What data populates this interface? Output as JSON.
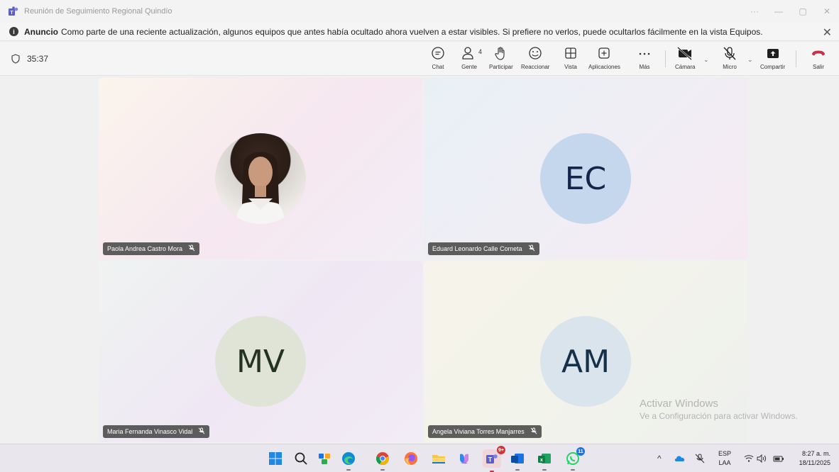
{
  "window": {
    "title": "Reunión de Seguimiento Regional Quindío"
  },
  "announcement": {
    "label": "Anuncio",
    "text": "Como parte de una reciente actualización, algunos equipos que antes había ocultado ahora vuelven a estar visibles. Si prefiere no verlos, puede ocultarlos fácilmente en la vista Equipos."
  },
  "toolbar": {
    "timer": "35:37",
    "chat": "Chat",
    "people": "Gente",
    "people_count": "4",
    "raise": "Participar",
    "react": "Reaccionar",
    "view": "Vista",
    "apps": "Aplicaciones",
    "more": "Más",
    "camera": "Cámara",
    "mic": "Micro",
    "share": "Compartir",
    "leave": "Salir"
  },
  "participants": [
    {
      "name": "Paola Andrea Castro Mora",
      "initials": "",
      "muted": true
    },
    {
      "name": "Eduard Leonardo Calle Cometa",
      "initials": "EC",
      "muted": true
    },
    {
      "name": "Maria Fernanda Vinasco Vidal",
      "initials": "MV",
      "muted": true
    },
    {
      "name": "Angela Viviana Torres Manjarres",
      "initials": "AM",
      "muted": true
    }
  ],
  "watermark": {
    "line1": "Activar Windows",
    "line2": "Ve a Configuración para activar Windows."
  },
  "taskbar": {
    "teams_badge": "9+",
    "whatsapp_badge": "11",
    "lang1": "ESP",
    "lang2": "LAA",
    "time": "8:27 a. m.",
    "date": "18/11/2025"
  },
  "colors": {
    "leave_red": "#c4314b",
    "teams_purple": "#5b5fc7"
  }
}
